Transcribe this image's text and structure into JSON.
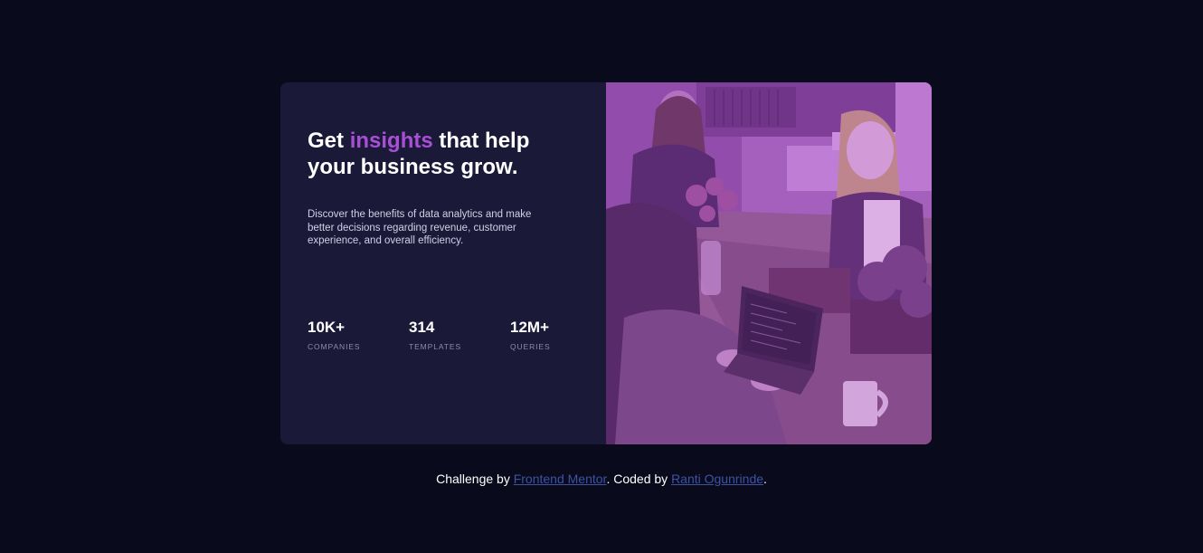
{
  "card": {
    "headline": {
      "part1": "Get ",
      "accent": "insights",
      "part2": " that help your business grow."
    },
    "description": "Discover the benefits of data analytics and make better decisions regarding revenue, customer experience, and overall efficiency.",
    "stats": [
      {
        "value": "10K+",
        "label": "COMPANIES"
      },
      {
        "value": "314",
        "label": "TEMPLATES"
      },
      {
        "value": "12M+",
        "label": "QUERIES"
      }
    ],
    "image_subject": "people-working-at-table-photo",
    "image_tint": "#a94fd6"
  },
  "footer": {
    "prefix": "Challenge by ",
    "link1": "Frontend Mentor",
    "middle": ". Coded by ",
    "link2": "Ranti Ogunrinde",
    "suffix": "."
  },
  "colors": {
    "page_bg": "#090b1c",
    "card_bg": "#1b1938",
    "accent": "#a94fd6",
    "link": "#3e52a3"
  }
}
